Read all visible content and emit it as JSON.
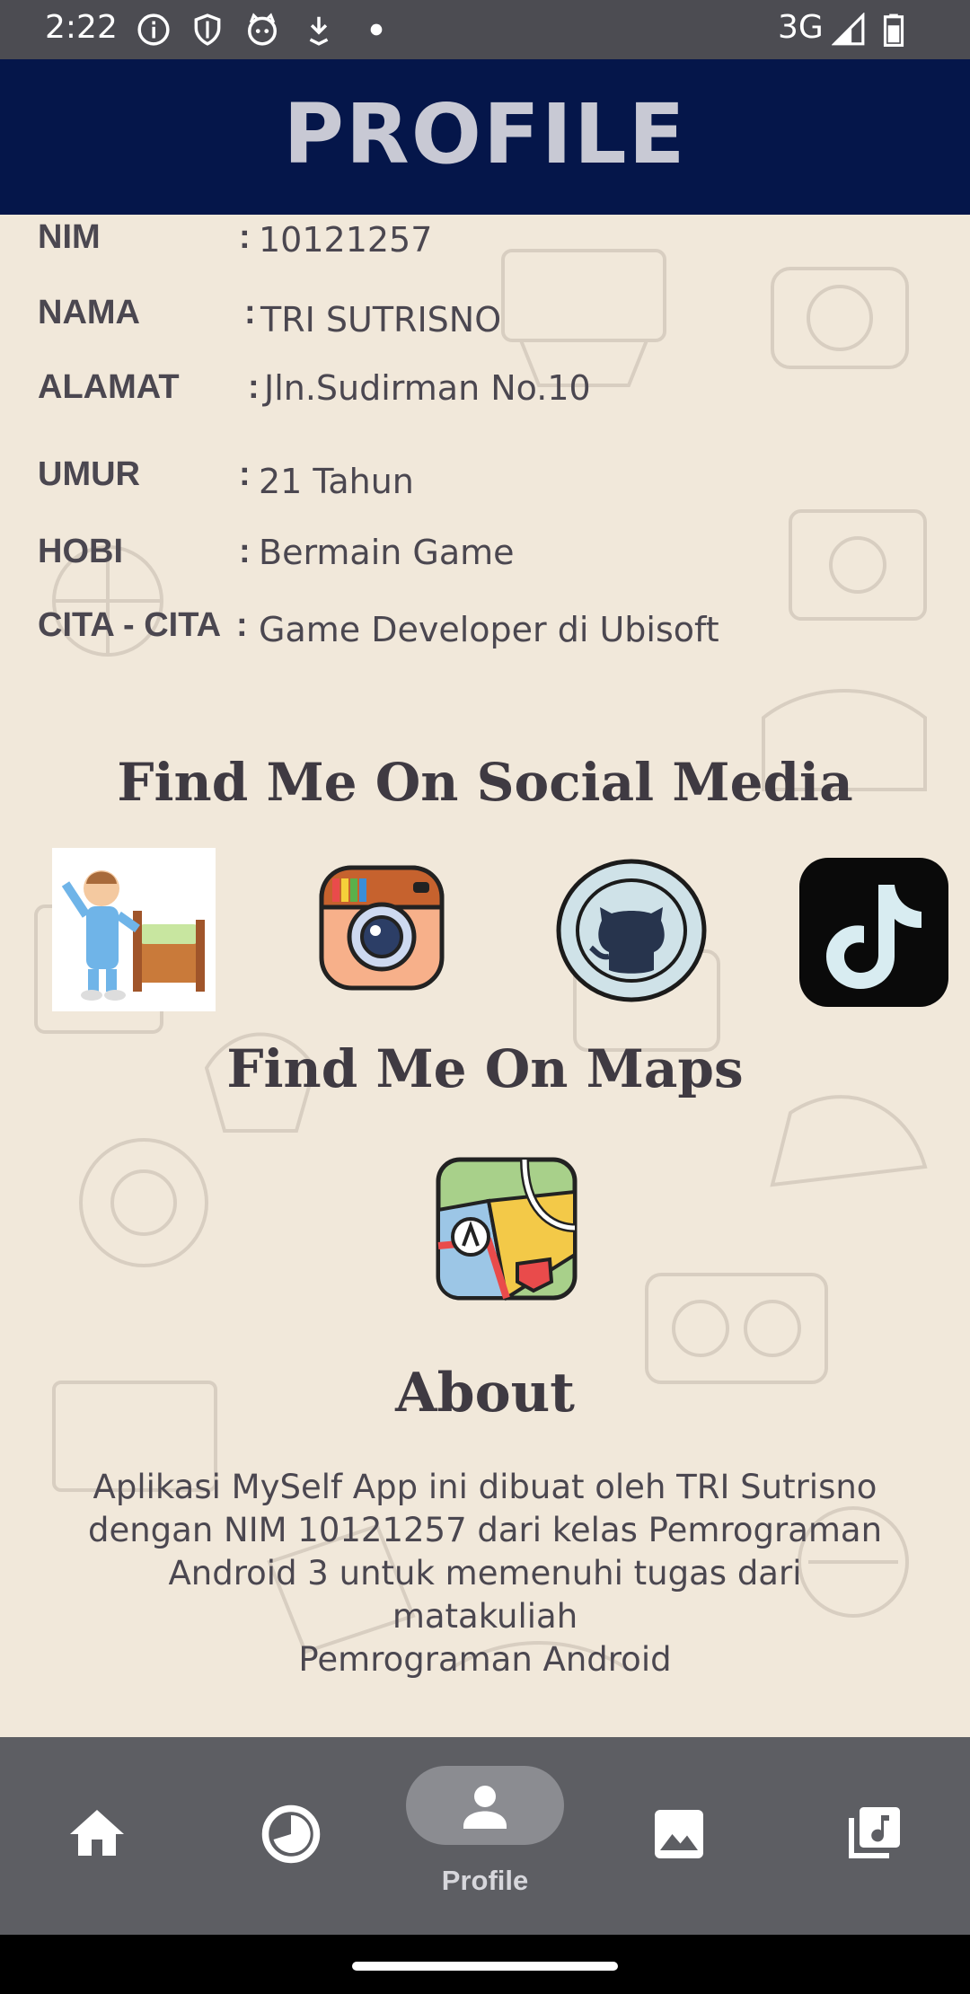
{
  "status_bar": {
    "time": "2:22",
    "network": "3G",
    "icons": [
      "info-icon",
      "shield-icon",
      "cat-icon",
      "download-icon",
      "dot-icon",
      "signal-icon",
      "battery-icon"
    ]
  },
  "app_bar": {
    "title": "PROFILE"
  },
  "profile": {
    "rows": [
      {
        "label": "NIM",
        "colon": ":",
        "value": "10121257"
      },
      {
        "label": "NAMA",
        "colon": ":",
        "value": "TRI SUTRISNO"
      },
      {
        "label": "ALAMAT",
        "colon": ":",
        "value": "Jln.Sudirman No.10"
      },
      {
        "label": "UMUR",
        "colon": ":",
        "value": "21 Tahun"
      },
      {
        "label": "HOBI",
        "colon": ":",
        "value": "Bermain Game"
      },
      {
        "label": "CITA - CITA",
        "colon": ":",
        "value": "Game Developer di Ubisoft"
      }
    ]
  },
  "social": {
    "heading": "Find Me On Social Media",
    "items": [
      "sleeping-boy-icon",
      "instagram-icon",
      "github-icon",
      "tiktok-icon"
    ]
  },
  "maps": {
    "heading": "Find Me On Maps",
    "icon": "map-icon"
  },
  "about": {
    "heading": "About",
    "lines": [
      "Aplikasi MySelf App ini dibuat oleh TRI Sutrisno",
      "dengan NIM 10121257 dari kelas Pemrograman",
      "Android 3 untuk memenuhi tugas dari matakuliah",
      "Pemrograman Android"
    ]
  },
  "bottom_nav": {
    "items": [
      {
        "icon": "home-icon",
        "label": ""
      },
      {
        "icon": "clock-icon",
        "label": ""
      },
      {
        "icon": "person-icon",
        "label": "Profile",
        "selected": true
      },
      {
        "icon": "image-icon",
        "label": ""
      },
      {
        "icon": "music-library-icon",
        "label": ""
      }
    ]
  },
  "colors": {
    "app_bar": "#05164a",
    "background": "#f1e8da",
    "text": "#4b4750",
    "nav_bar": "#5d5e63"
  }
}
